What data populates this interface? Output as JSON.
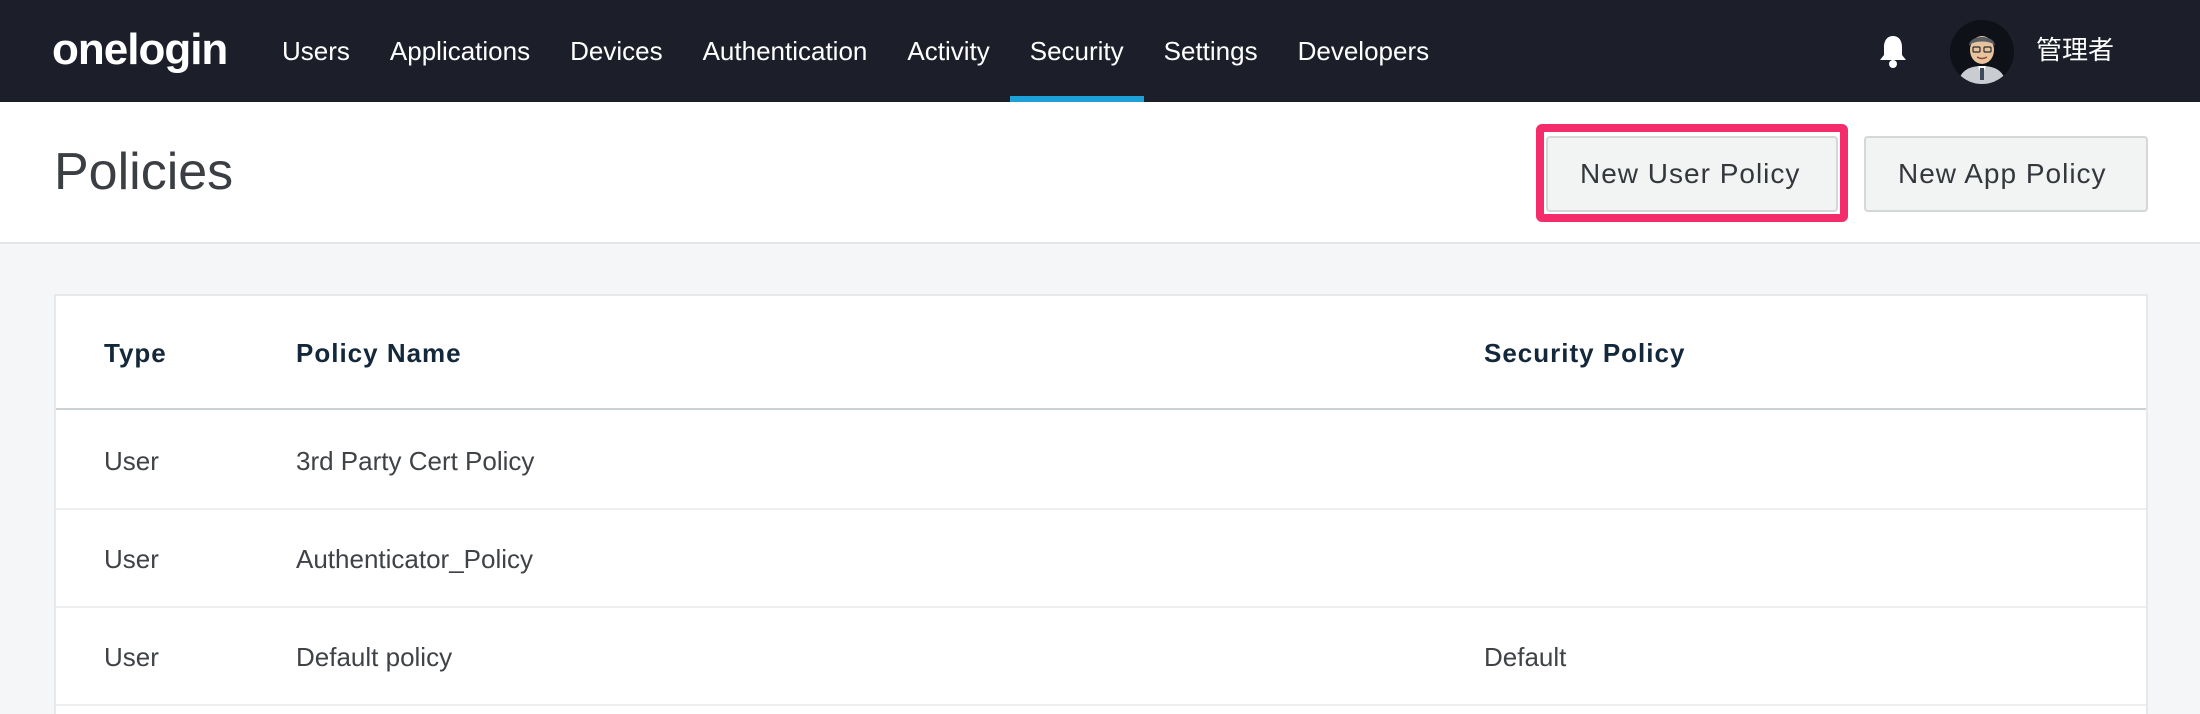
{
  "nav": {
    "logo": "onelogin",
    "items": [
      {
        "label": "Users",
        "active": false
      },
      {
        "label": "Applications",
        "active": false
      },
      {
        "label": "Devices",
        "active": false
      },
      {
        "label": "Authentication",
        "active": false
      },
      {
        "label": "Activity",
        "active": false
      },
      {
        "label": "Security",
        "active": true
      },
      {
        "label": "Settings",
        "active": false
      },
      {
        "label": "Developers",
        "active": false
      }
    ],
    "notification_icon": "bell-icon",
    "user_name": "管理者"
  },
  "header": {
    "title": "Policies",
    "new_user_policy_label": "New User Policy",
    "new_app_policy_label": "New App Policy"
  },
  "table": {
    "columns": [
      "Type",
      "Policy Name",
      "Security Policy"
    ],
    "rows": [
      {
        "type": "User",
        "name": "3rd Party Cert Policy",
        "security": ""
      },
      {
        "type": "User",
        "name": "Authenticator_Policy",
        "security": ""
      },
      {
        "type": "User",
        "name": "Default policy",
        "security": "Default"
      }
    ]
  },
  "colors": {
    "nav_bg": "#1c1f2a",
    "active_tab": "#1ea0d8",
    "highlight": "#f42c6c"
  }
}
